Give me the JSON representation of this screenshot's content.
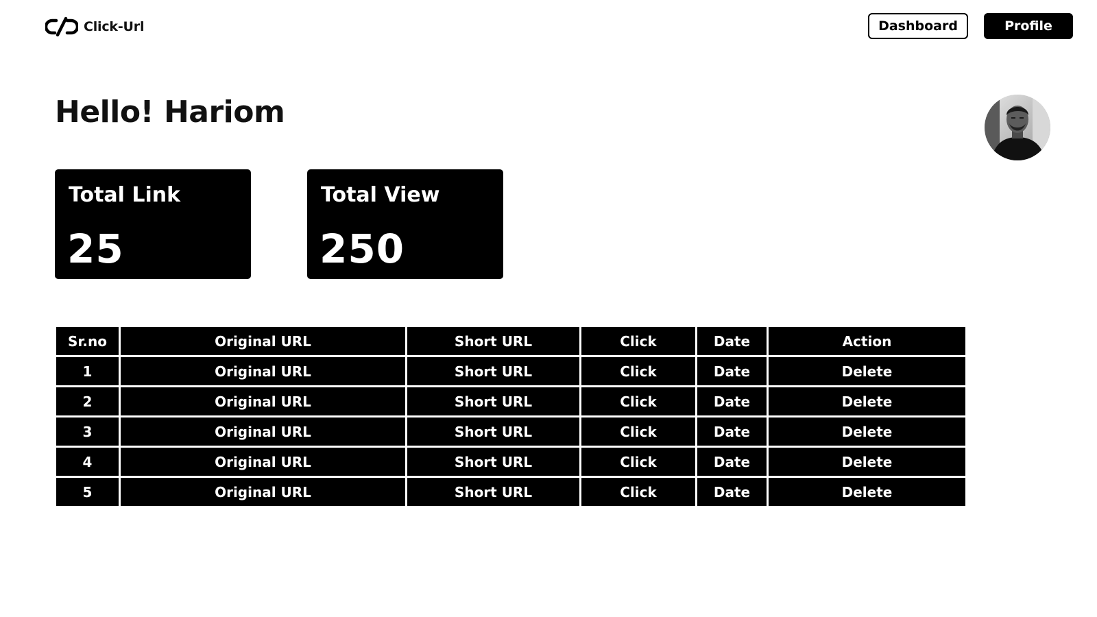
{
  "brand": {
    "name": "Click-Url",
    "icon": "link-icon"
  },
  "nav": {
    "dashboard_label": "Dashboard",
    "profile_label": "Profile"
  },
  "greeting": "Hello! Hariom",
  "stats": {
    "total_link": {
      "label": "Total Link",
      "value": "25"
    },
    "total_view": {
      "label": "Total View",
      "value": "250"
    }
  },
  "table": {
    "headers": [
      "Sr.no",
      "Original URL",
      "Short URL",
      "Click",
      "Date",
      "Action"
    ],
    "rows": [
      [
        "1",
        "Original URL",
        "Short URL",
        "Click",
        "Date",
        "Delete"
      ],
      [
        "2",
        "Original URL",
        "Short URL",
        "Click",
        "Date",
        "Delete"
      ],
      [
        "3",
        "Original URL",
        "Short URL",
        "Click",
        "Date",
        "Delete"
      ],
      [
        "4",
        "Original URL",
        "Short URL",
        "Click",
        "Date",
        "Delete"
      ],
      [
        "5",
        "Original URL",
        "Short URL",
        "Click",
        "Date",
        "Delete"
      ]
    ]
  },
  "colors": {
    "primary": "#000000",
    "background": "#ffffff",
    "text_on_dark": "#ffffff"
  }
}
